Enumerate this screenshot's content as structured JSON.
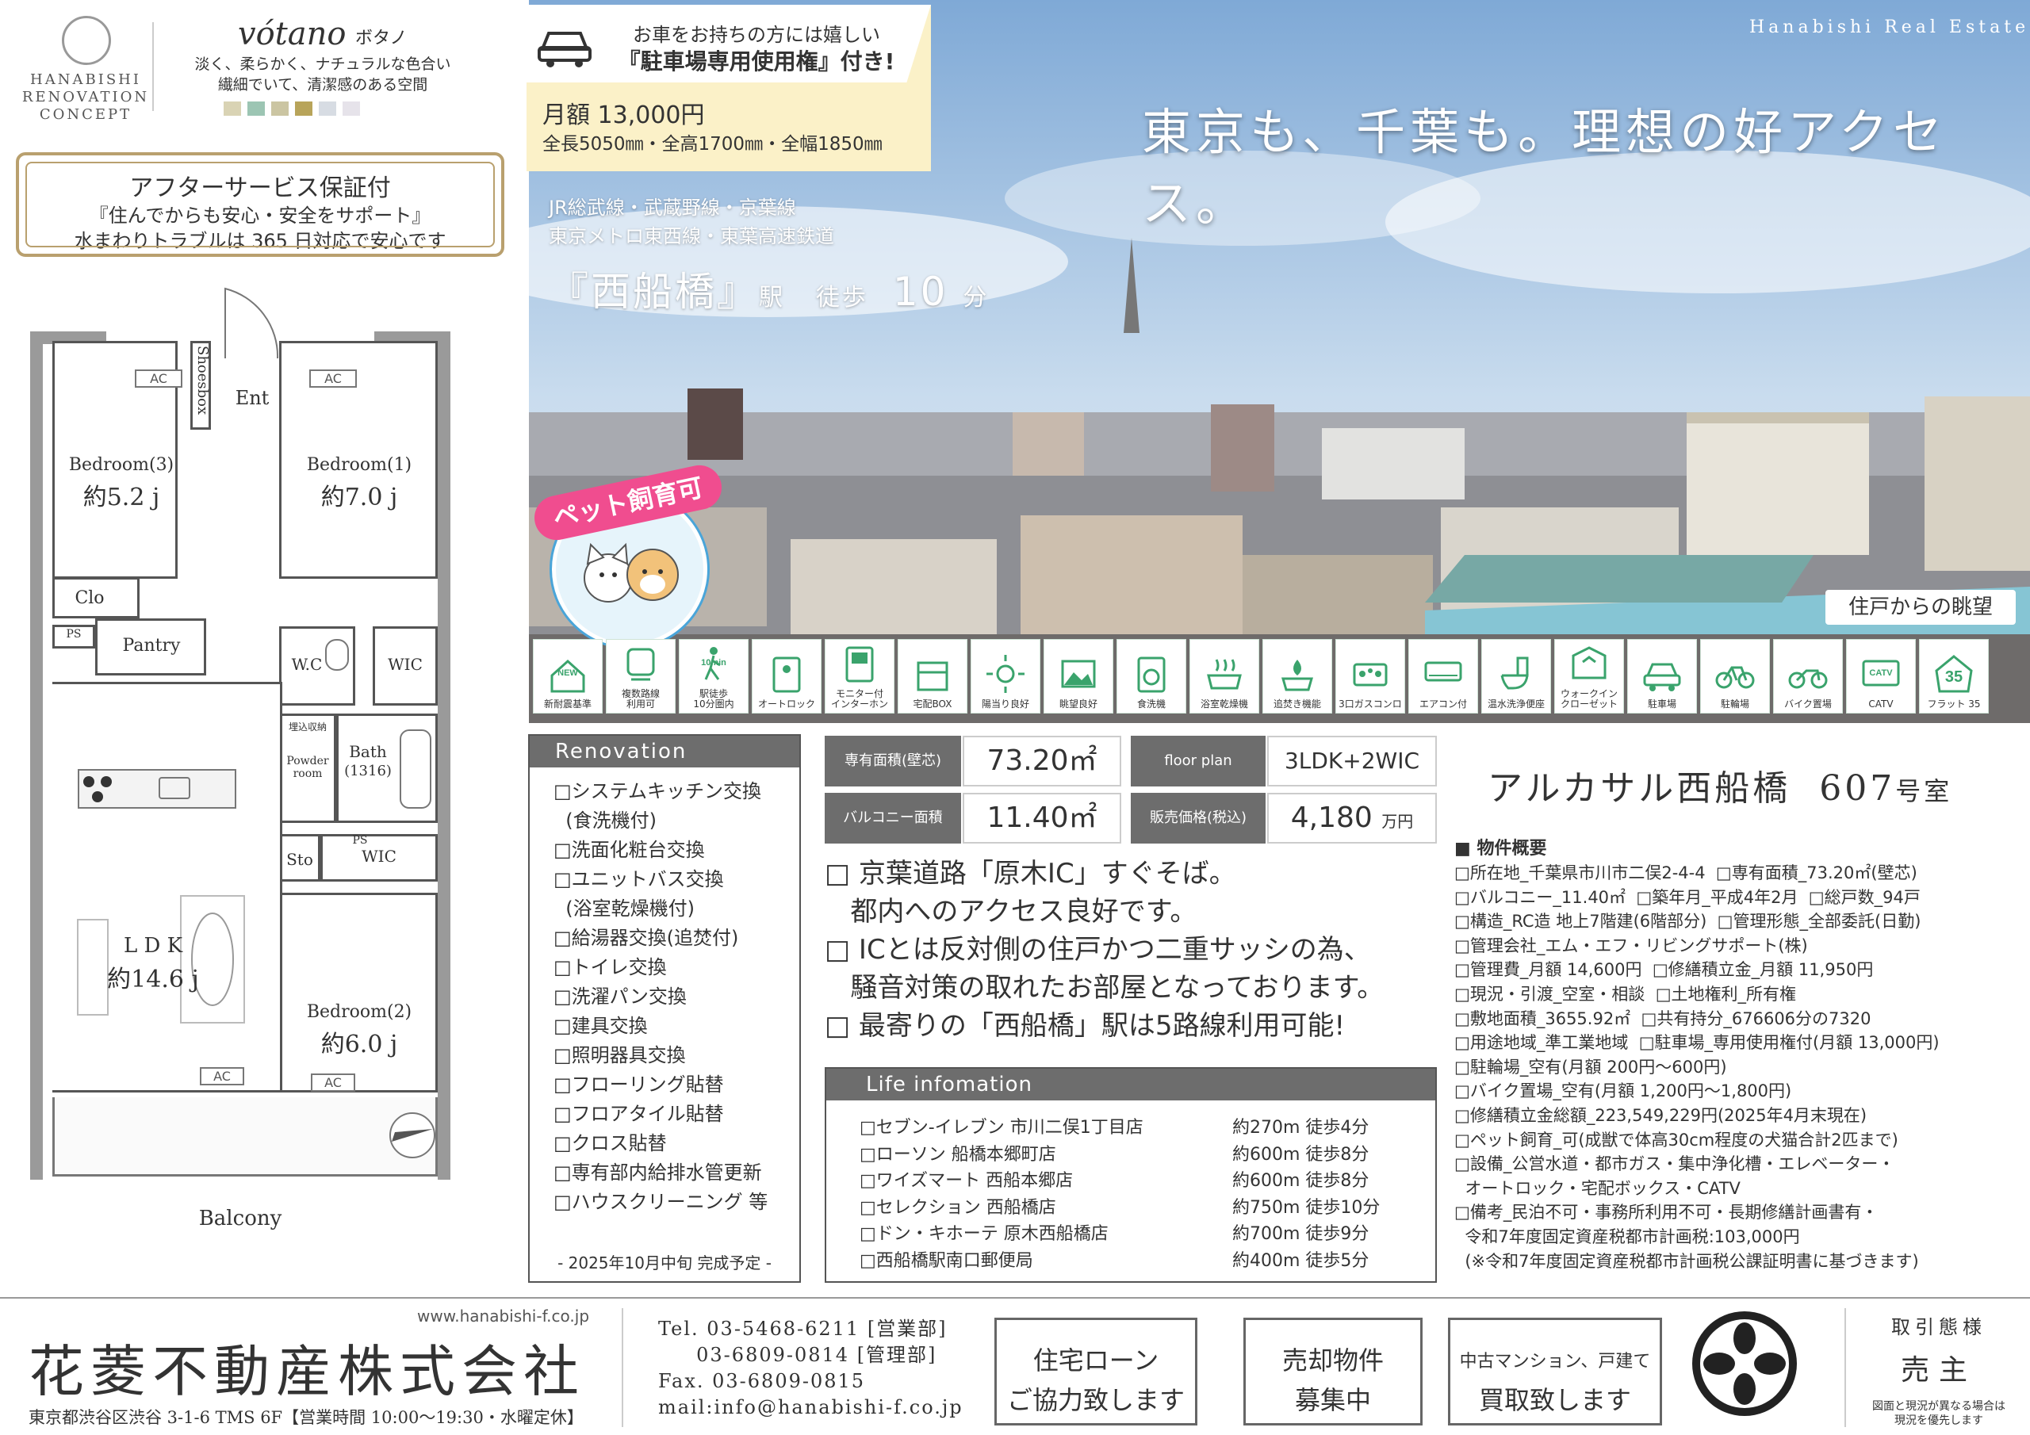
{
  "concept": {
    "brand_lines": [
      "HANABISHI",
      "RENOVATION",
      "CONCEPT"
    ],
    "title": "vótano",
    "title_kana": "ボタノ",
    "tagline_1": "淡く、柔らかく、ナチュラルな色合い",
    "tagline_2": "繊細でいて、清潔感のある空間",
    "swatch_colors": [
      "#d9d3b4",
      "#9cc5b3",
      "#cbc5a2",
      "#b8a45a",
      "#d7dce3",
      "#e6e3ea"
    ]
  },
  "after_service": {
    "title": "アフターサービス保証付",
    "line1": "『住んでからも安心・安全をサポート』",
    "line2": "水まわりトラブルは 365 日対応で安心です"
  },
  "floorplan": {
    "shoes": "Shoesbox",
    "ent": "Ent",
    "bed3_name": "Bedroom(3)",
    "bed3_size": "約5.2 j",
    "bed1_name": "Bedroom(1)",
    "bed1_size": "約7.0 j",
    "clo": "Clo",
    "ps": "PS",
    "pantry": "Pantry",
    "wc": "W.C",
    "wic": "WIC",
    "bath": "Bath",
    "bath_size": "(1316)",
    "buried": "埋込収納",
    "powder": "Powder",
    "powder2": "room",
    "sto": "Sto",
    "ldk": "L D K",
    "ldk_size": "約14.6 j",
    "bed2_name": "Bedroom(2)",
    "bed2_size": "約6.0 j",
    "balcony": "Balcony",
    "ac": "AC"
  },
  "photo": {
    "brand": "Hanabishi Real Estate",
    "headline": "東京も、千葉も。理想の好アクセス。",
    "caption": "住戸からの眺望"
  },
  "parking": {
    "line1": "お車をお持ちの方には嬉しい",
    "line2": "『駐車場専用使用権』付き!",
    "price": "月額 13,000円",
    "size": "全長5050㎜・全高1700㎜・全幅1850㎜"
  },
  "station": {
    "lines1": "JR総武線・武蔵野線・京葉線",
    "lines2": "東京メトロ東西線・東葉高速鉄道",
    "name": "『西船橋』",
    "eki": "駅",
    "walk": "徒歩",
    "minutes": "10",
    "fun": "分"
  },
  "pet_badge": "ペット飼育可",
  "features": [
    {
      "label": "新耐震基準",
      "icon": "new-house-icon",
      "tag": "NEW"
    },
    {
      "label": "複数路線\n利用可",
      "icon": "train-route-icon"
    },
    {
      "label": "駅徒歩\n10分圏内",
      "icon": "walking-icon",
      "tag": "10min"
    },
    {
      "label": "オートロック",
      "icon": "autolock-icon"
    },
    {
      "label": "モニター付\nインターホン",
      "icon": "intercom-icon"
    },
    {
      "label": "宅配BOX",
      "icon": "delivery-box-icon"
    },
    {
      "label": "陽当り良好",
      "icon": "sun-icon"
    },
    {
      "label": "眺望良好",
      "icon": "view-icon"
    },
    {
      "label": "食洗機",
      "icon": "dishwasher-icon"
    },
    {
      "label": "浴室乾燥機",
      "icon": "bath-dryer-icon"
    },
    {
      "label": "追焚き機能",
      "icon": "reheat-icon"
    },
    {
      "label": "3口ガスコンロ",
      "icon": "gas-stove-icon"
    },
    {
      "label": "エアコン付",
      "icon": "aircon-icon"
    },
    {
      "label": "温水洗浄便座",
      "icon": "toilet-icon"
    },
    {
      "label": "ウォークイン\nクローゼット",
      "icon": "closet-icon"
    },
    {
      "label": "駐車場",
      "icon": "car-icon"
    },
    {
      "label": "駐輪場",
      "icon": "bicycle-icon"
    },
    {
      "label": "バイク置場",
      "icon": "motorbike-icon"
    },
    {
      "label": "CATV",
      "icon": "catv-icon",
      "tag": "CATV"
    },
    {
      "label": "フラット 35",
      "icon": "flat35-icon",
      "tag": "35"
    }
  ],
  "renovation": {
    "header": "Renovation",
    "items": [
      "□システムキッチン交換",
      "  (食洗機付)",
      "□洗面化粧台交換",
      "□ユニットバス交換",
      "  (浴室乾燥機付)",
      "□給湯器交換(追焚付)",
      "□トイレ交換",
      "□洗濯パン交換",
      "□建具交換",
      "□照明器具交換",
      "□フローリング貼替",
      "□フロアタイル貼替",
      "□クロス貼替",
      "□専有部内給排水管更新",
      "□ハウスクリーニング 等"
    ],
    "footer": "- 2025年10月中旬 完成予定 -"
  },
  "spec": {
    "area_label": "専有面積(壁芯)",
    "area_value": "73.20㎡",
    "plan_label": "floor plan",
    "plan_value": "3LDK+2WIC",
    "balcony_label": "バルコニー面積",
    "balcony_value": "11.40㎡",
    "price_label": "販売価格(税込)",
    "price_value": "4,180",
    "price_unit": "万円"
  },
  "points": [
    "□ 京葉道路「原木IC」すぐそば。",
    "   都内へのアクセス良好です。",
    "□ ICとは反対側の住戸かつ二重サッシの為、",
    "   騒音対策の取れたお部屋となっております。",
    "□ 最寄りの「西船橋」駅は5路線利用可能!"
  ],
  "life": {
    "header": "Life infomation",
    "rows": [
      {
        "name": "□セブン-イレブン 市川二俣1丁目店",
        "dist": "約270m 徒歩4分"
      },
      {
        "name": "□ローソン 船橋本郷町店",
        "dist": "約600m 徒歩8分"
      },
      {
        "name": "□ワイズマート 西船本郷店",
        "dist": "約600m 徒歩8分"
      },
      {
        "name": "□セレクション 西船橋店",
        "dist": "約750m 徒歩10分"
      },
      {
        "name": "□ドン・キホーテ 原木西船橋店",
        "dist": "約700m 徒歩9分"
      },
      {
        "name": "□西船橋駅南口郵便局",
        "dist": "約400m 徒歩5分"
      }
    ]
  },
  "property": {
    "name": "アルカサル西船橋",
    "room": "607",
    "room_suffix": "号室",
    "overview_title": "■ 物件概要",
    "overview": [
      "□所在地_千葉県市川市二俣2-4-4  □専有面積_73.20㎡(壁芯)",
      "□バルコニー_11.40㎡  □築年月_平成4年2月  □総戸数_94戸",
      "□構造_RC造 地上7階建(6階部分)  □管理形態_全部委託(日勤)",
      "□管理会社_エム・エフ・リビングサポート(株)",
      "□管理費_月額 14,600円  □修繕積立金_月額 11,950円",
      "□現況・引渡_空室・相談  □土地権利_所有権",
      "□敷地面積_3655.92㎡  □共有持分_676606分の7320",
      "□用途地域_準工業地域  □駐車場_専用使用権付(月額 13,000円)",
      "□駐輪場_空有(月額 200円〜600円)",
      "□バイク置場_空有(月額 1,200円〜1,800円)",
      "□修繕積立金総額_223,549,229円(2025年4月末現在)",
      "□ペット飼育_可(成獣で体高30cm程度の犬猫合計2匹まで)",
      "□設備_公営水道・都市ガス・集中浄化槽・エレベーター・",
      "  オートロック・宅配ボックス・CATV",
      "□備考_民泊不可・事務所利用不可・長期修繕計画書有・",
      "  令和7年度固定資産税都市計画税:103,000円",
      "  (※令和7年度固定資産税都市計画税公課証明書に基づきます)"
    ]
  },
  "footer": {
    "url": "www.hanabishi-f.co.jp",
    "company": "花菱不動産株式会社",
    "address": "東京都渋谷区渋谷 3-1-6 TMS 6F【営業時間 10:00〜19:30・水曜定休】",
    "contacts": "Tel. 03-5468-6211 [営業部]\n     03-6809-0814 [管理部]\nFax. 03-6809-0815\nmail:info@hanabishi-f.co.jp",
    "box1_a": "住宅ローン",
    "box1_b": "ご協力致します",
    "box2_a": "売却物件",
    "box2_b": "募集中",
    "box3_a": "中古マンション、戸建て",
    "box3_b": "買取致します",
    "role_title": "取引態様",
    "role_value": "売主",
    "role_note": "図面と現況が異なる場合は\n現況を優先します"
  }
}
